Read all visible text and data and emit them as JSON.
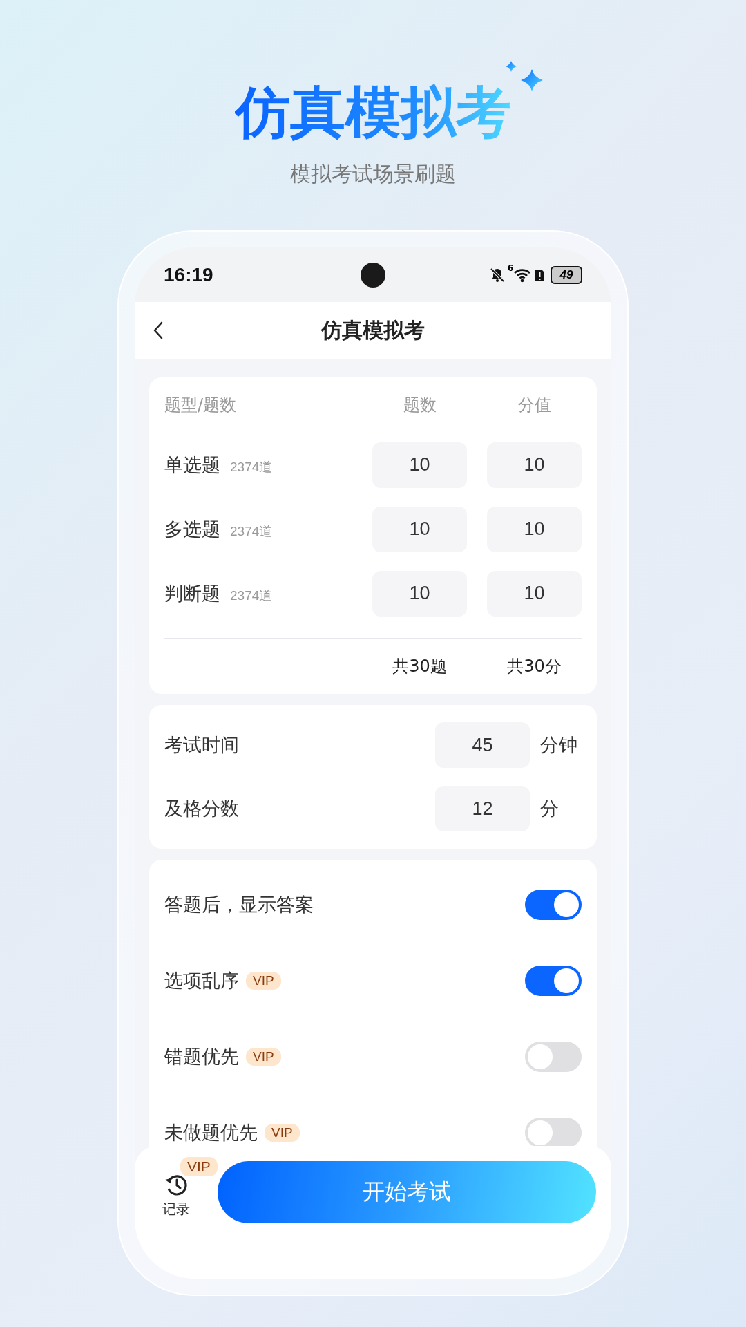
{
  "promo": {
    "title": "仿真模拟考",
    "subtitle": "模拟考试场景刷题"
  },
  "status_bar": {
    "time": "16:19",
    "wifi_tag": "6",
    "battery": "49"
  },
  "nav": {
    "title": "仿真模拟考"
  },
  "question_table": {
    "columns": [
      "题型/题数",
      "题数",
      "分值"
    ],
    "rows": [
      {
        "type": "单选题",
        "available": "2374道",
        "count": "10",
        "score": "10"
      },
      {
        "type": "多选题",
        "available": "2374道",
        "count": "10",
        "score": "10"
      },
      {
        "type": "判断题",
        "available": "2374道",
        "count": "10",
        "score": "10"
      }
    ],
    "totals": {
      "count": "共30题",
      "score": "共30分"
    }
  },
  "exam_settings": [
    {
      "label": "考试时间",
      "value": "45",
      "unit": "分钟"
    },
    {
      "label": "及格分数",
      "value": "12",
      "unit": "分"
    }
  ],
  "options": [
    {
      "label": "答题后，显示答案",
      "on": true
    },
    {
      "label": "选项乱序",
      "badge": "VIP",
      "on": true
    },
    {
      "label": "错题优先",
      "badge": "VIP",
      "on": false
    },
    {
      "label": "未做题优先",
      "badge": "VIP",
      "on": false
    }
  ],
  "bottom_bar": {
    "record_label": "记录",
    "record_badge": "VIP",
    "start_button": "开始考试"
  }
}
